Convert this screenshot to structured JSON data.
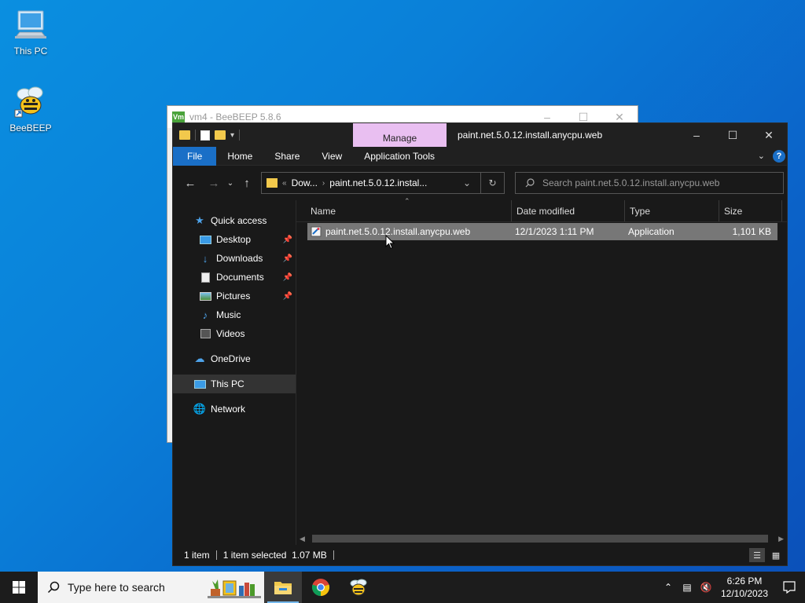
{
  "desktop": {
    "icons": [
      {
        "label": "This PC"
      },
      {
        "label": "BeeBEEP"
      }
    ]
  },
  "background_window": {
    "title": "vm4 - BeeBEEP 5.8.6",
    "badge": "Vm"
  },
  "explorer": {
    "context_tab": "Manage",
    "title": "paint.net.5.0.12.install.anycpu.web",
    "ribbon_tabs": [
      "File",
      "Home",
      "Share",
      "View",
      "Application Tools"
    ],
    "address": {
      "crumb_prefix": "«",
      "crumb1": "Dow...",
      "crumb2": "paint.net.5.0.12.instal..."
    },
    "search_placeholder": "Search paint.net.5.0.12.install.anycpu.web",
    "sidebar": {
      "quick_access": "Quick access",
      "items": [
        "Desktop",
        "Downloads",
        "Documents",
        "Pictures",
        "Music",
        "Videos"
      ],
      "onedrive": "OneDrive",
      "this_pc": "This PC",
      "network": "Network"
    },
    "columns": [
      "Name",
      "Date modified",
      "Type",
      "Size"
    ],
    "files": [
      {
        "name": "paint.net.5.0.12.install.anycpu.web",
        "date": "12/1/2023 1:11 PM",
        "type": "Application",
        "size": "1,101 KB"
      }
    ],
    "status": {
      "count": "1 item",
      "selection": "1 item selected  1.07 MB"
    }
  },
  "taskbar": {
    "search_placeholder": "Type here to search",
    "time": "6:26 PM",
    "date": "12/10/2023"
  },
  "colors": {
    "accent": "#1a6fc7",
    "manage_tab": "#e9bff1",
    "selection": "#777777"
  }
}
